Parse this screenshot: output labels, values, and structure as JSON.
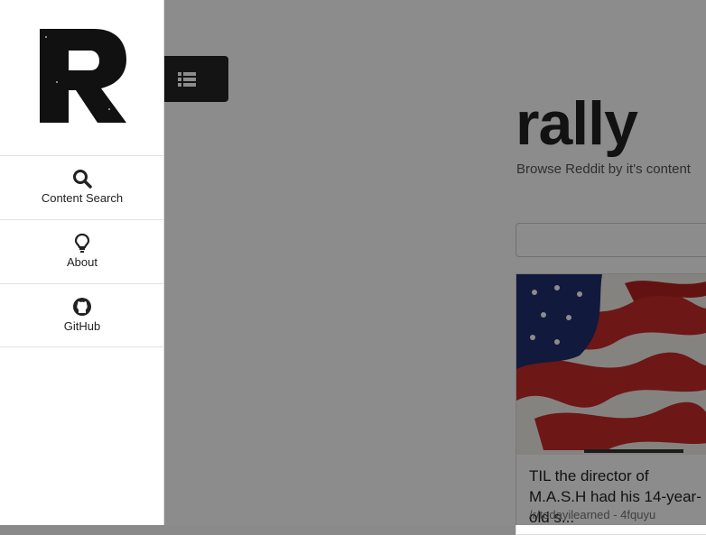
{
  "sidebar": {
    "logo_letter": "R",
    "items": [
      {
        "label": "Content Search",
        "icon": "search-icon"
      },
      {
        "label": "About",
        "icon": "lightbulb-icon"
      },
      {
        "label": "GitHub",
        "icon": "github-icon"
      }
    ]
  },
  "header": {
    "menu_icon": "list-icon",
    "title": "rally",
    "subtitle": "Browse Reddit by it's content"
  },
  "search": {
    "placeholder": ""
  },
  "results": [
    {
      "title": "TIL the director of M.A.S.H had his 14-year-old s...",
      "subreddit": "/r/todayilearned",
      "id": "4fquyu",
      "meta": "/r/todayilearned - 4fquyu",
      "image": "american-flag-image"
    }
  ]
}
